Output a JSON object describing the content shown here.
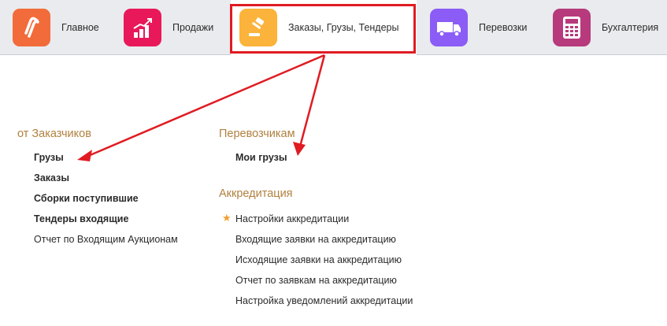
{
  "nav": {
    "tabs": [
      {
        "label": "Главное",
        "icon": "logo-icon",
        "color": "#f26b3a"
      },
      {
        "label": "Продажи",
        "icon": "chart-icon",
        "color": "#e8185a"
      },
      {
        "label": "Заказы,  Грузы, Тендеры",
        "icon": "gavel-icon",
        "color": "#fbb33b"
      },
      {
        "label": "Перевозки",
        "icon": "truck-icon",
        "color": "#8b5cf6"
      },
      {
        "label": "Бухгалтерия",
        "icon": "calculator-icon",
        "color": "#b73a7c"
      }
    ]
  },
  "left": {
    "title": "от Заказчиков",
    "items": [
      "Грузы",
      "Заказы",
      "Сборки поступившие",
      "Тендеры входящие",
      "Отчет по Входящим Аукционам"
    ]
  },
  "right": {
    "carriers_title": "Перевозчикам",
    "carriers_items": [
      "Мои грузы"
    ],
    "accreditation_title": "Аккредитация",
    "accreditation_items": [
      "Настройки аккредитации",
      "Входящие заявки на аккредитацию",
      "Исходящие заявки на аккредитацию",
      "Отчет по заявкам на аккредитацию",
      "Настройка уведомлений аккредитации"
    ]
  },
  "colors": {
    "highlight": "#e01b22",
    "section_title": "#b1803f",
    "star": "#f0a030"
  }
}
